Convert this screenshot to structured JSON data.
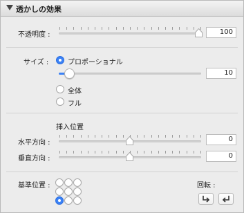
{
  "header": {
    "title": "透かしの効果"
  },
  "opacity": {
    "label": "不透明度 :",
    "value": "100",
    "fraction": 1.0
  },
  "size": {
    "label": "サイズ :",
    "options": [
      {
        "label": "プロポーショナル",
        "selected": true
      },
      {
        "label": "全体",
        "selected": false
      },
      {
        "label": "フル",
        "selected": false
      }
    ],
    "value": "10",
    "fraction": 0.08
  },
  "position": {
    "heading": "挿入位置",
    "horizontal": {
      "label": "水平方向 :",
      "value": "0",
      "fraction": 0.5
    },
    "vertical": {
      "label": "垂直方向 :",
      "value": "0",
      "fraction": 0.5
    }
  },
  "anchor": {
    "label": "基準位置 :",
    "selected_index": 6
  },
  "rotate": {
    "label": "回転 :",
    "buttons": [
      "rotate-right-icon",
      "rotate-left-icon"
    ]
  },
  "colors": {
    "accent": "#3b82f6"
  }
}
